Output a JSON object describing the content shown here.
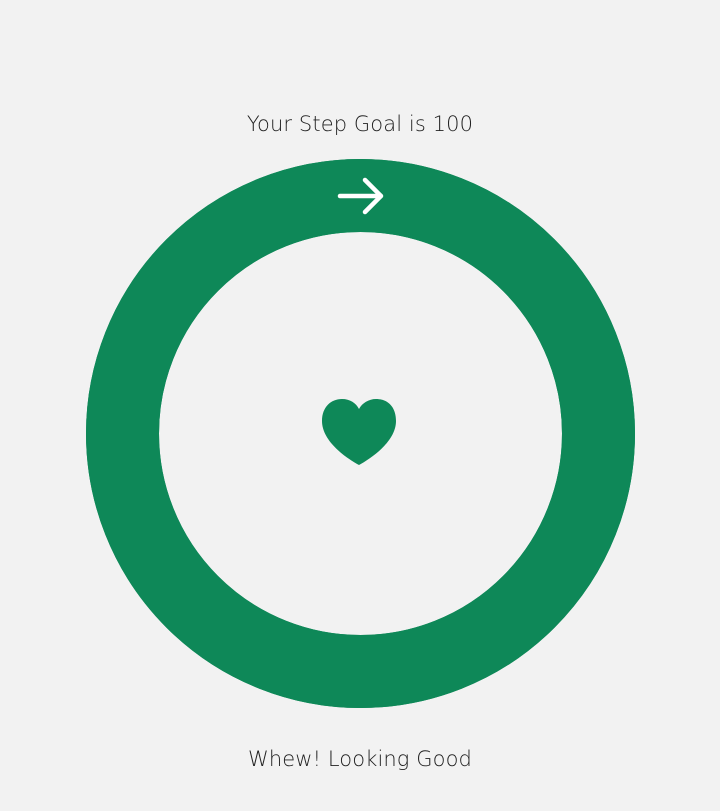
{
  "goal": {
    "label": "Your Step Goal is 100",
    "target_steps": 100
  },
  "progress": {
    "fraction": 1.0,
    "ring_color": "#0e8858",
    "track_color": "#0e8858",
    "start_icon": "arrow-right-icon",
    "center_icon": "heart-icon",
    "center_icon_color": "#0e8858",
    "arrow_color": "#ffffff"
  },
  "status": {
    "message": "Whew! Looking Good"
  },
  "theme": {
    "background": "#f2f2f2",
    "text_color": "#222222"
  }
}
